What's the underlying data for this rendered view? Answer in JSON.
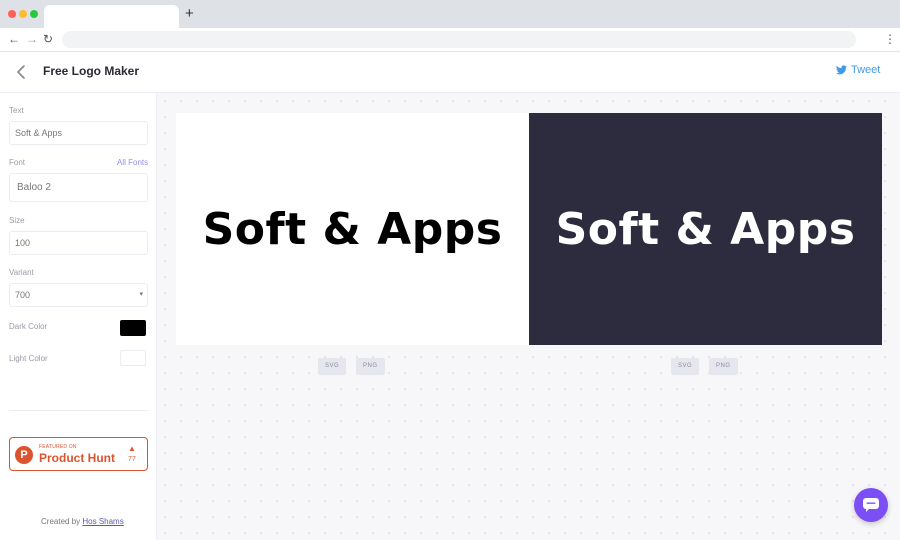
{
  "header": {
    "title": "Free Logo Maker",
    "tweet_label": "Tweet"
  },
  "sidebar": {
    "text_label": "Text",
    "text_value": "Soft & Apps",
    "font_label": "Font",
    "all_fonts_link": "All Fonts",
    "font_value": "Baloo 2",
    "size_label": "Size",
    "size_value": "100",
    "variant_label": "Variant",
    "variant_value": "700",
    "dark_color_label": "Dark Color",
    "dark_color_value": "#000000",
    "light_color_label": "Light Color",
    "light_color_value": "#ffffff",
    "product_hunt": {
      "featured": "FEATURED ON",
      "name": "Product Hunt",
      "upvotes": "77"
    },
    "credit_prefix": "Created by",
    "credit_link": "Hos Shams"
  },
  "previews": [
    {
      "theme": "light",
      "text": "Soft & Apps",
      "background": "#ffffff",
      "color": "#000000"
    },
    {
      "theme": "dark",
      "text": "Soft & Apps",
      "background": "#2c2c3e",
      "color": "#ffffff"
    }
  ],
  "download_buttons": {
    "svg_label": "SVG",
    "png_label": "PNG"
  },
  "colors": {
    "accent": "#7c4ef5",
    "product_hunt": "#da552f",
    "twitter": "#3d9be9"
  },
  "icons": {
    "back": "chevron-left-icon",
    "tweet": "twitter-bird-icon",
    "product_hunt": "product-hunt-logo-icon",
    "chat": "chat-bubble-icon"
  }
}
